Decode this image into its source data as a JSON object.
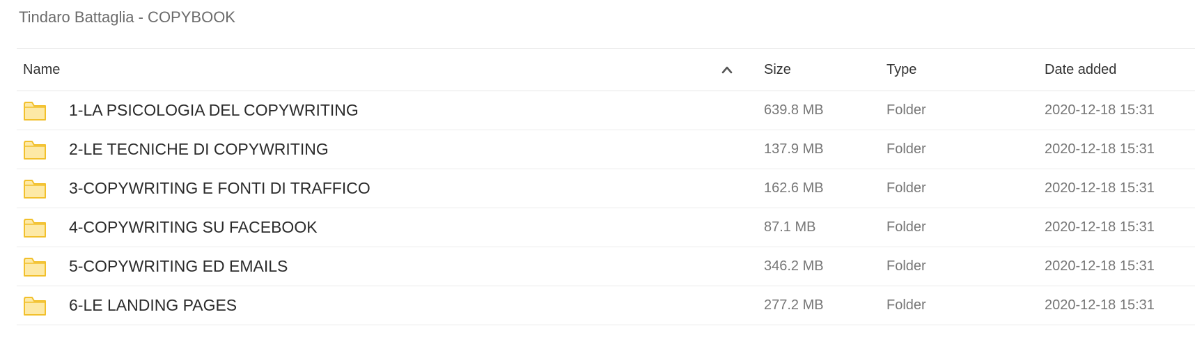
{
  "breadcrumb": "Tindaro Battaglia - COPYBOOK",
  "columns": {
    "name": "Name",
    "size": "Size",
    "type": "Type",
    "date_added": "Date added",
    "sort_icon": "chevron-up-icon"
  },
  "colors": {
    "folder_fill": "#fde9a6",
    "folder_stroke": "#f2c02c"
  },
  "rows": [
    {
      "name": "1-LA PSICOLOGIA DEL COPYWRITING",
      "size": "639.8 MB",
      "type": "Folder",
      "date": "2020-12-18 15:31",
      "icon": "folder-icon"
    },
    {
      "name": "2-LE TECNICHE DI COPYWRITING",
      "size": "137.9 MB",
      "type": "Folder",
      "date": "2020-12-18 15:31",
      "icon": "folder-icon"
    },
    {
      "name": "3-COPYWRITING E FONTI DI TRAFFICO",
      "size": "162.6 MB",
      "type": "Folder",
      "date": "2020-12-18 15:31",
      "icon": "folder-icon"
    },
    {
      "name": "4-COPYWRITING SU FACEBOOK",
      "size": "87.1 MB",
      "type": "Folder",
      "date": "2020-12-18 15:31",
      "icon": "folder-icon"
    },
    {
      "name": "5-COPYWRITING ED EMAILS",
      "size": "346.2 MB",
      "type": "Folder",
      "date": "2020-12-18 15:31",
      "icon": "folder-icon"
    },
    {
      "name": "6-LE LANDING PAGES",
      "size": "277.2 MB",
      "type": "Folder",
      "date": "2020-12-18 15:31",
      "icon": "folder-icon"
    }
  ]
}
